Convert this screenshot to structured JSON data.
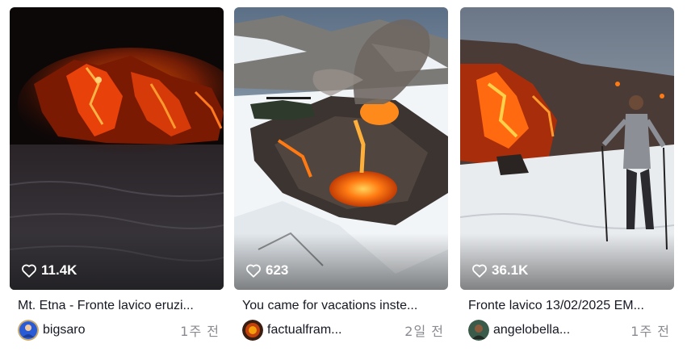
{
  "videos": [
    {
      "likes": "11.4K",
      "title": "Mt. Etna - Fronte lavico eruzi...",
      "author": "bigsaro",
      "age": "1주 전",
      "avatar_color": "#2a5bd7"
    },
    {
      "likes": "623",
      "title": "You came for vacations inste...",
      "author": "factualfram...",
      "age": "2일 전",
      "avatar_color": "#c2410c"
    },
    {
      "likes": "36.1K",
      "title": "Fronte lavico 13/02/2025 EM...",
      "author": "angelobella...",
      "age": "1주 전",
      "avatar_color": "#3b5b4a"
    }
  ],
  "icons": {
    "likes": "heart-outline-icon"
  }
}
